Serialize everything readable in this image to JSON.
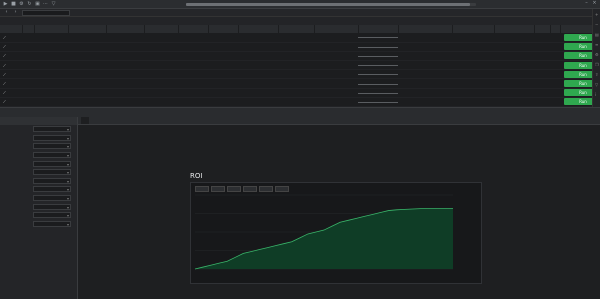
{
  "toolbar": {
    "status": "",
    "progress": 0.98
  },
  "symbol": {
    "value": ""
  },
  "summary": {
    "text": ""
  },
  "grid": {
    "headers": [
      "",
      "",
      "",
      "",
      "",
      "",
      "",
      "",
      "",
      "",
      "",
      "",
      "",
      "",
      "",
      "",
      "",
      ""
    ],
    "rows": [
      {
        "id": "",
        "c": [
          "",
          "",
          "",
          "",
          "",
          "",
          "",
          "",
          "",
          "",
          "",
          "",
          "",
          "",
          ""
        ],
        "button": "Run",
        "selected": false
      },
      {
        "id": "",
        "c": [
          "",
          "",
          "",
          "",
          "",
          "",
          "",
          "",
          "",
          "",
          "",
          "",
          "",
          "",
          ""
        ],
        "button": "Run",
        "selected": false
      },
      {
        "id": "",
        "c": [
          "",
          "",
          "",
          "",
          "",
          "",
          "",
          "",
          "",
          "",
          "",
          "",
          "",
          "",
          ""
        ],
        "button": "Run",
        "selected": false
      },
      {
        "id": "",
        "c": [
          "",
          "",
          "",
          "",
          "",
          "",
          "",
          "",
          "",
          "",
          "",
          "",
          "",
          "",
          ""
        ],
        "button": "Run",
        "selected": false
      },
      {
        "id": "",
        "c": [
          "",
          "",
          "",
          "",
          "",
          "",
          "",
          "",
          "",
          "",
          "",
          "",
          "",
          "",
          ""
        ],
        "button": "Run",
        "selected": false
      },
      {
        "id": "",
        "c": [
          "",
          "",
          "",
          "",
          "",
          "",
          "",
          "",
          "",
          "",
          "",
          "",
          "",
          "",
          ""
        ],
        "button": "Run",
        "selected": false
      },
      {
        "id": "",
        "c": [
          "",
          "",
          "",
          "",
          "",
          "",
          "",
          "",
          "",
          "",
          "",
          "",
          "",
          "",
          ""
        ],
        "button": "Run",
        "selected": false
      },
      {
        "id": "",
        "c": [
          "",
          "",
          "",
          "",
          "",
          "",
          "",
          "",
          "",
          "",
          "",
          "",
          "",
          "",
          ""
        ],
        "button": "Run",
        "selected": false
      }
    ]
  },
  "params": {
    "title": "",
    "rows": [
      {
        "label": "",
        "value": ""
      },
      {
        "label": "",
        "value": ""
      },
      {
        "label": "",
        "value": ""
      },
      {
        "label": "",
        "value": ""
      },
      {
        "label": "",
        "value": ""
      },
      {
        "label": "",
        "value": ""
      },
      {
        "label": "",
        "value": ""
      },
      {
        "label": "",
        "value": ""
      },
      {
        "label": "",
        "value": ""
      },
      {
        "label": "",
        "value": ""
      },
      {
        "label": "",
        "value": ""
      },
      {
        "label": "",
        "value": ""
      }
    ]
  },
  "tabs": [
    "",
    "",
    "",
    ""
  ],
  "stats": {
    "rows": [
      {
        "l1": "",
        "v1": "",
        "l2": "",
        "v2": "",
        "l3": "",
        "v3": ""
      },
      {
        "l1": "",
        "v1": "",
        "l2": "",
        "v2": "",
        "l3": "",
        "v3": ""
      },
      {
        "l1": "",
        "v1": "",
        "l2": "",
        "v2": "",
        "l3": "",
        "v3": ""
      },
      {
        "l1": "",
        "v1": "",
        "l2": "",
        "v2": "",
        "l3": "",
        "v3": ""
      },
      {
        "l1": "",
        "v1": "",
        "l2": "",
        "v2": "",
        "l3": "",
        "v3": ""
      }
    ]
  },
  "roi": {
    "title": "ROI",
    "ranges": [
      "",
      "",
      "",
      "",
      "",
      ""
    ],
    "legend": [
      "",
      ""
    ]
  },
  "drawdown_title": "",
  "chart_data": {
    "type": "area",
    "title": "ROI",
    "x": [
      0,
      1,
      2,
      3,
      4,
      5,
      6,
      7,
      8,
      9,
      10,
      11,
      12,
      13,
      14,
      15,
      16,
      17,
      18,
      19,
      20,
      21,
      22,
      23,
      24,
      25,
      26,
      27,
      28,
      29,
      30,
      31,
      32
    ],
    "values": [
      0,
      0.5,
      1,
      1.5,
      2,
      3,
      4,
      4.5,
      5,
      5.5,
      6,
      6.5,
      7,
      8,
      9,
      9.5,
      10,
      11,
      12,
      12.5,
      13,
      13.5,
      14,
      14.5,
      15,
      15.2,
      15.3,
      15.4,
      15.5,
      15.5,
      15.5,
      15.5,
      15.5
    ],
    "ylim": [
      0,
      19
    ],
    "yticks": [
      "",
      "",
      "",
      "",
      "",
      "",
      "",
      ""
    ],
    "fill_color": "#0f3d26",
    "line_color": "#39b66a"
  }
}
